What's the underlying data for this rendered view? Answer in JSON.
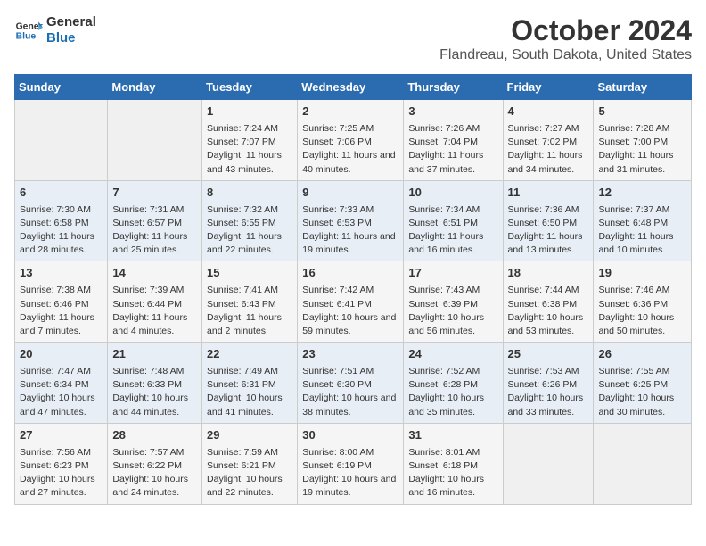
{
  "logo": {
    "line1": "General",
    "line2": "Blue"
  },
  "title": "October 2024",
  "subtitle": "Flandreau, South Dakota, United States",
  "days_of_week": [
    "Sunday",
    "Monday",
    "Tuesday",
    "Wednesday",
    "Thursday",
    "Friday",
    "Saturday"
  ],
  "weeks": [
    [
      {
        "day": "",
        "info": ""
      },
      {
        "day": "",
        "info": ""
      },
      {
        "day": "1",
        "info": "Sunrise: 7:24 AM\nSunset: 7:07 PM\nDaylight: 11 hours and 43 minutes."
      },
      {
        "day": "2",
        "info": "Sunrise: 7:25 AM\nSunset: 7:06 PM\nDaylight: 11 hours and 40 minutes."
      },
      {
        "day": "3",
        "info": "Sunrise: 7:26 AM\nSunset: 7:04 PM\nDaylight: 11 hours and 37 minutes."
      },
      {
        "day": "4",
        "info": "Sunrise: 7:27 AM\nSunset: 7:02 PM\nDaylight: 11 hours and 34 minutes."
      },
      {
        "day": "5",
        "info": "Sunrise: 7:28 AM\nSunset: 7:00 PM\nDaylight: 11 hours and 31 minutes."
      }
    ],
    [
      {
        "day": "6",
        "info": "Sunrise: 7:30 AM\nSunset: 6:58 PM\nDaylight: 11 hours and 28 minutes."
      },
      {
        "day": "7",
        "info": "Sunrise: 7:31 AM\nSunset: 6:57 PM\nDaylight: 11 hours and 25 minutes."
      },
      {
        "day": "8",
        "info": "Sunrise: 7:32 AM\nSunset: 6:55 PM\nDaylight: 11 hours and 22 minutes."
      },
      {
        "day": "9",
        "info": "Sunrise: 7:33 AM\nSunset: 6:53 PM\nDaylight: 11 hours and 19 minutes."
      },
      {
        "day": "10",
        "info": "Sunrise: 7:34 AM\nSunset: 6:51 PM\nDaylight: 11 hours and 16 minutes."
      },
      {
        "day": "11",
        "info": "Sunrise: 7:36 AM\nSunset: 6:50 PM\nDaylight: 11 hours and 13 minutes."
      },
      {
        "day": "12",
        "info": "Sunrise: 7:37 AM\nSunset: 6:48 PM\nDaylight: 11 hours and 10 minutes."
      }
    ],
    [
      {
        "day": "13",
        "info": "Sunrise: 7:38 AM\nSunset: 6:46 PM\nDaylight: 11 hours and 7 minutes."
      },
      {
        "day": "14",
        "info": "Sunrise: 7:39 AM\nSunset: 6:44 PM\nDaylight: 11 hours and 4 minutes."
      },
      {
        "day": "15",
        "info": "Sunrise: 7:41 AM\nSunset: 6:43 PM\nDaylight: 11 hours and 2 minutes."
      },
      {
        "day": "16",
        "info": "Sunrise: 7:42 AM\nSunset: 6:41 PM\nDaylight: 10 hours and 59 minutes."
      },
      {
        "day": "17",
        "info": "Sunrise: 7:43 AM\nSunset: 6:39 PM\nDaylight: 10 hours and 56 minutes."
      },
      {
        "day": "18",
        "info": "Sunrise: 7:44 AM\nSunset: 6:38 PM\nDaylight: 10 hours and 53 minutes."
      },
      {
        "day": "19",
        "info": "Sunrise: 7:46 AM\nSunset: 6:36 PM\nDaylight: 10 hours and 50 minutes."
      }
    ],
    [
      {
        "day": "20",
        "info": "Sunrise: 7:47 AM\nSunset: 6:34 PM\nDaylight: 10 hours and 47 minutes."
      },
      {
        "day": "21",
        "info": "Sunrise: 7:48 AM\nSunset: 6:33 PM\nDaylight: 10 hours and 44 minutes."
      },
      {
        "day": "22",
        "info": "Sunrise: 7:49 AM\nSunset: 6:31 PM\nDaylight: 10 hours and 41 minutes."
      },
      {
        "day": "23",
        "info": "Sunrise: 7:51 AM\nSunset: 6:30 PM\nDaylight: 10 hours and 38 minutes."
      },
      {
        "day": "24",
        "info": "Sunrise: 7:52 AM\nSunset: 6:28 PM\nDaylight: 10 hours and 35 minutes."
      },
      {
        "day": "25",
        "info": "Sunrise: 7:53 AM\nSunset: 6:26 PM\nDaylight: 10 hours and 33 minutes."
      },
      {
        "day": "26",
        "info": "Sunrise: 7:55 AM\nSunset: 6:25 PM\nDaylight: 10 hours and 30 minutes."
      }
    ],
    [
      {
        "day": "27",
        "info": "Sunrise: 7:56 AM\nSunset: 6:23 PM\nDaylight: 10 hours and 27 minutes."
      },
      {
        "day": "28",
        "info": "Sunrise: 7:57 AM\nSunset: 6:22 PM\nDaylight: 10 hours and 24 minutes."
      },
      {
        "day": "29",
        "info": "Sunrise: 7:59 AM\nSunset: 6:21 PM\nDaylight: 10 hours and 22 minutes."
      },
      {
        "day": "30",
        "info": "Sunrise: 8:00 AM\nSunset: 6:19 PM\nDaylight: 10 hours and 19 minutes."
      },
      {
        "day": "31",
        "info": "Sunrise: 8:01 AM\nSunset: 6:18 PM\nDaylight: 10 hours and 16 minutes."
      },
      {
        "day": "",
        "info": ""
      },
      {
        "day": "",
        "info": ""
      }
    ]
  ]
}
